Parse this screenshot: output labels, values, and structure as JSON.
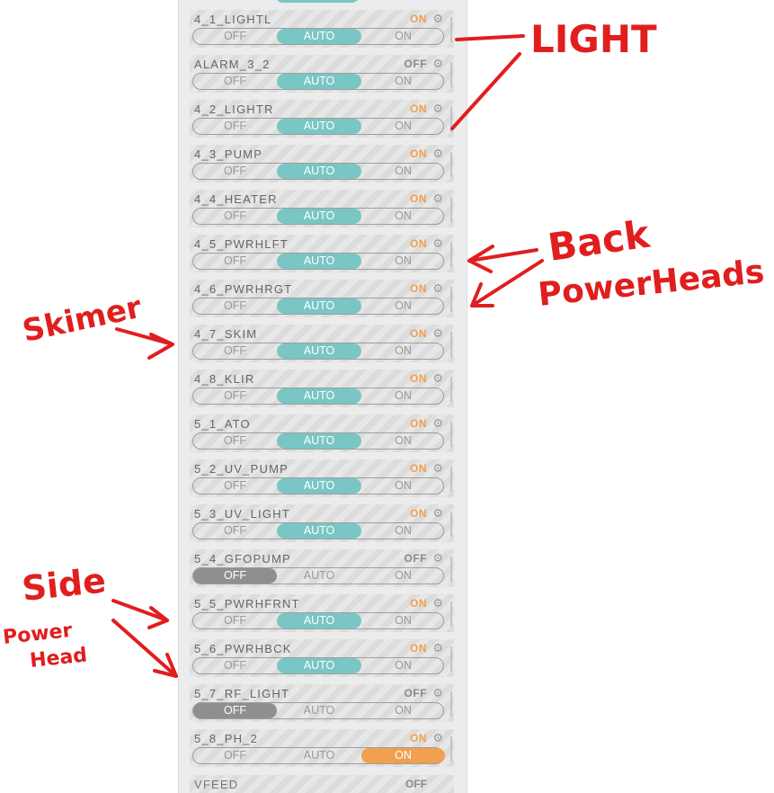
{
  "toggle_labels": {
    "off": "OFF",
    "auto": "AUTO",
    "on": "ON"
  },
  "outlets": [
    {
      "name": "4_1_LIGHTL",
      "state": "ON",
      "mode": "auto"
    },
    {
      "name": "ALARM_3_2",
      "state": "OFF",
      "mode": "auto"
    },
    {
      "name": "4_2_LIGHTR",
      "state": "ON",
      "mode": "auto"
    },
    {
      "name": "4_3_PUMP",
      "state": "ON",
      "mode": "auto"
    },
    {
      "name": "4_4_HEATER",
      "state": "ON",
      "mode": "auto"
    },
    {
      "name": "4_5_PWRHLFT",
      "state": "ON",
      "mode": "auto"
    },
    {
      "name": "4_6_PWRHRGT",
      "state": "ON",
      "mode": "auto"
    },
    {
      "name": "4_7_SKIM",
      "state": "ON",
      "mode": "auto"
    },
    {
      "name": "4_8_KLIR",
      "state": "ON",
      "mode": "auto"
    },
    {
      "name": "5_1_ATO",
      "state": "ON",
      "mode": "auto"
    },
    {
      "name": "5_2_UV_PUMP",
      "state": "ON",
      "mode": "auto"
    },
    {
      "name": "5_3_UV_LIGHT",
      "state": "ON",
      "mode": "auto"
    },
    {
      "name": "5_4_GFOPUMP",
      "state": "OFF",
      "mode": "off"
    },
    {
      "name": "5_5_PWRHFRNT",
      "state": "ON",
      "mode": "auto"
    },
    {
      "name": "5_6_PWRHBCK",
      "state": "ON",
      "mode": "auto"
    },
    {
      "name": "5_7_RF_LIGHT",
      "state": "OFF",
      "mode": "off"
    },
    {
      "name": "5_8_PH_2",
      "state": "ON",
      "mode": "on"
    }
  ],
  "bottom_outlet": {
    "name": "VFEED",
    "state": "OFF"
  },
  "annotations": {
    "light": "LIGHT",
    "back": "Back",
    "powerheads": "PowerHeads",
    "skimmer": "Skimer",
    "side": "Side",
    "power": "Power",
    "head": "Head"
  },
  "colors": {
    "auto": "#79c6c4",
    "on": "#f0a050",
    "off": "#8f8f8f",
    "annotation": "#e01e1e"
  }
}
